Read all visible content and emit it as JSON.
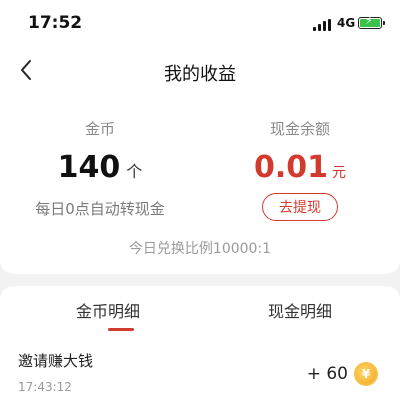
{
  "status_bar": {
    "time": "17:52",
    "network": "4G"
  },
  "header": {
    "title": "我的收益"
  },
  "coins": {
    "label": "金币",
    "value": "140",
    "unit": "个",
    "note": "每日0点自动转现金"
  },
  "cash": {
    "label": "现金余额",
    "value": "0.01",
    "unit": "元",
    "withdraw_label": "去提现"
  },
  "exchange_rate": "今日兑换比例10000:1",
  "tabs": [
    {
      "label": "金币明细",
      "active": true
    },
    {
      "label": "现金明细",
      "active": false
    }
  ],
  "records": [
    {
      "title": "邀请赚大钱",
      "time": "17:43:12",
      "amount": "+ 60"
    }
  ],
  "colors": {
    "accent": "#d13a2d",
    "battery": "#3cc24b",
    "coin": "#f3a71f"
  }
}
